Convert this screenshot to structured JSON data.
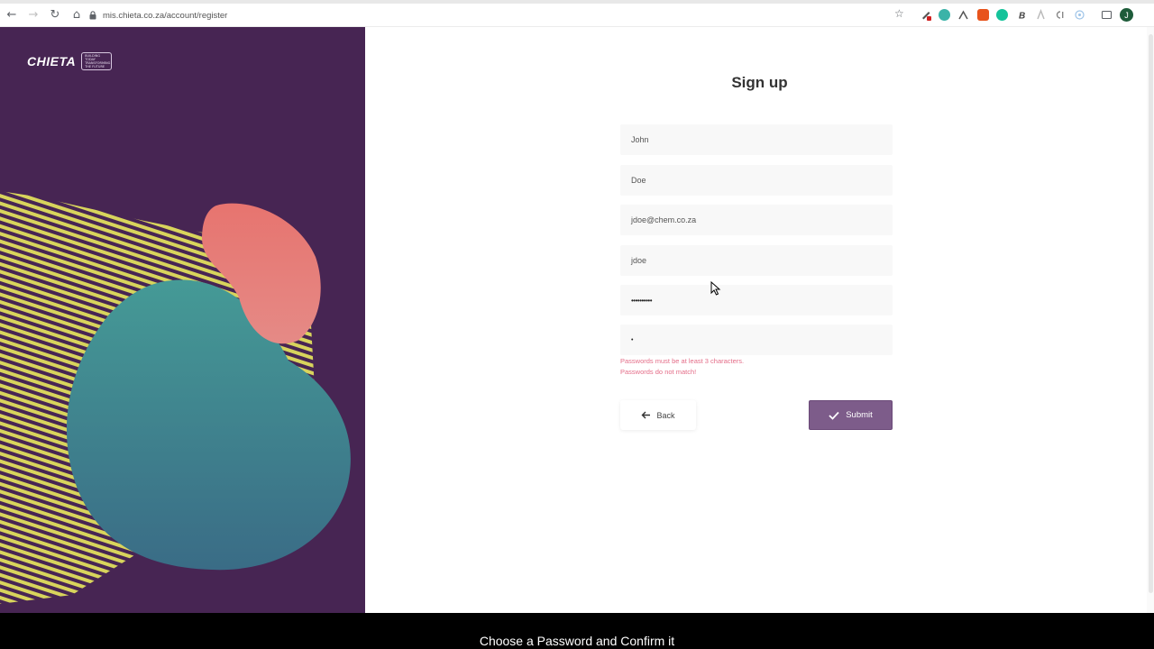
{
  "browser": {
    "url": "mis.chieta.co.za/account/register",
    "back_glyph": "←",
    "forward_glyph": "→",
    "reload_glyph": "↻",
    "home_glyph": "⌂",
    "star_glyph": "☆",
    "avatar_letter": "J"
  },
  "brand": {
    "logo_text": "CHIETA",
    "tagline": "BUILDING TODAY TRANSFORMING THE FUTURE",
    "panel_color": "#472553"
  },
  "form": {
    "title": "Sign up",
    "fields": [
      {
        "name": "first-name",
        "value": "John"
      },
      {
        "name": "last-name",
        "value": "Doe"
      },
      {
        "name": "email",
        "value": "jdoe@chem.co.za"
      },
      {
        "name": "username",
        "value": "jdoe"
      },
      {
        "name": "password",
        "value": "••••••••••"
      },
      {
        "name": "confirm-password",
        "value": "•"
      }
    ],
    "errors": [
      "Passwords must be at least 3 characters.",
      "Passwords do not match!"
    ],
    "back_label": "Back",
    "submit_label": "Submit",
    "accent_color": "#7d5c8a",
    "error_color": "#e46d88"
  },
  "caption": "Choose a Password and Confirm it"
}
